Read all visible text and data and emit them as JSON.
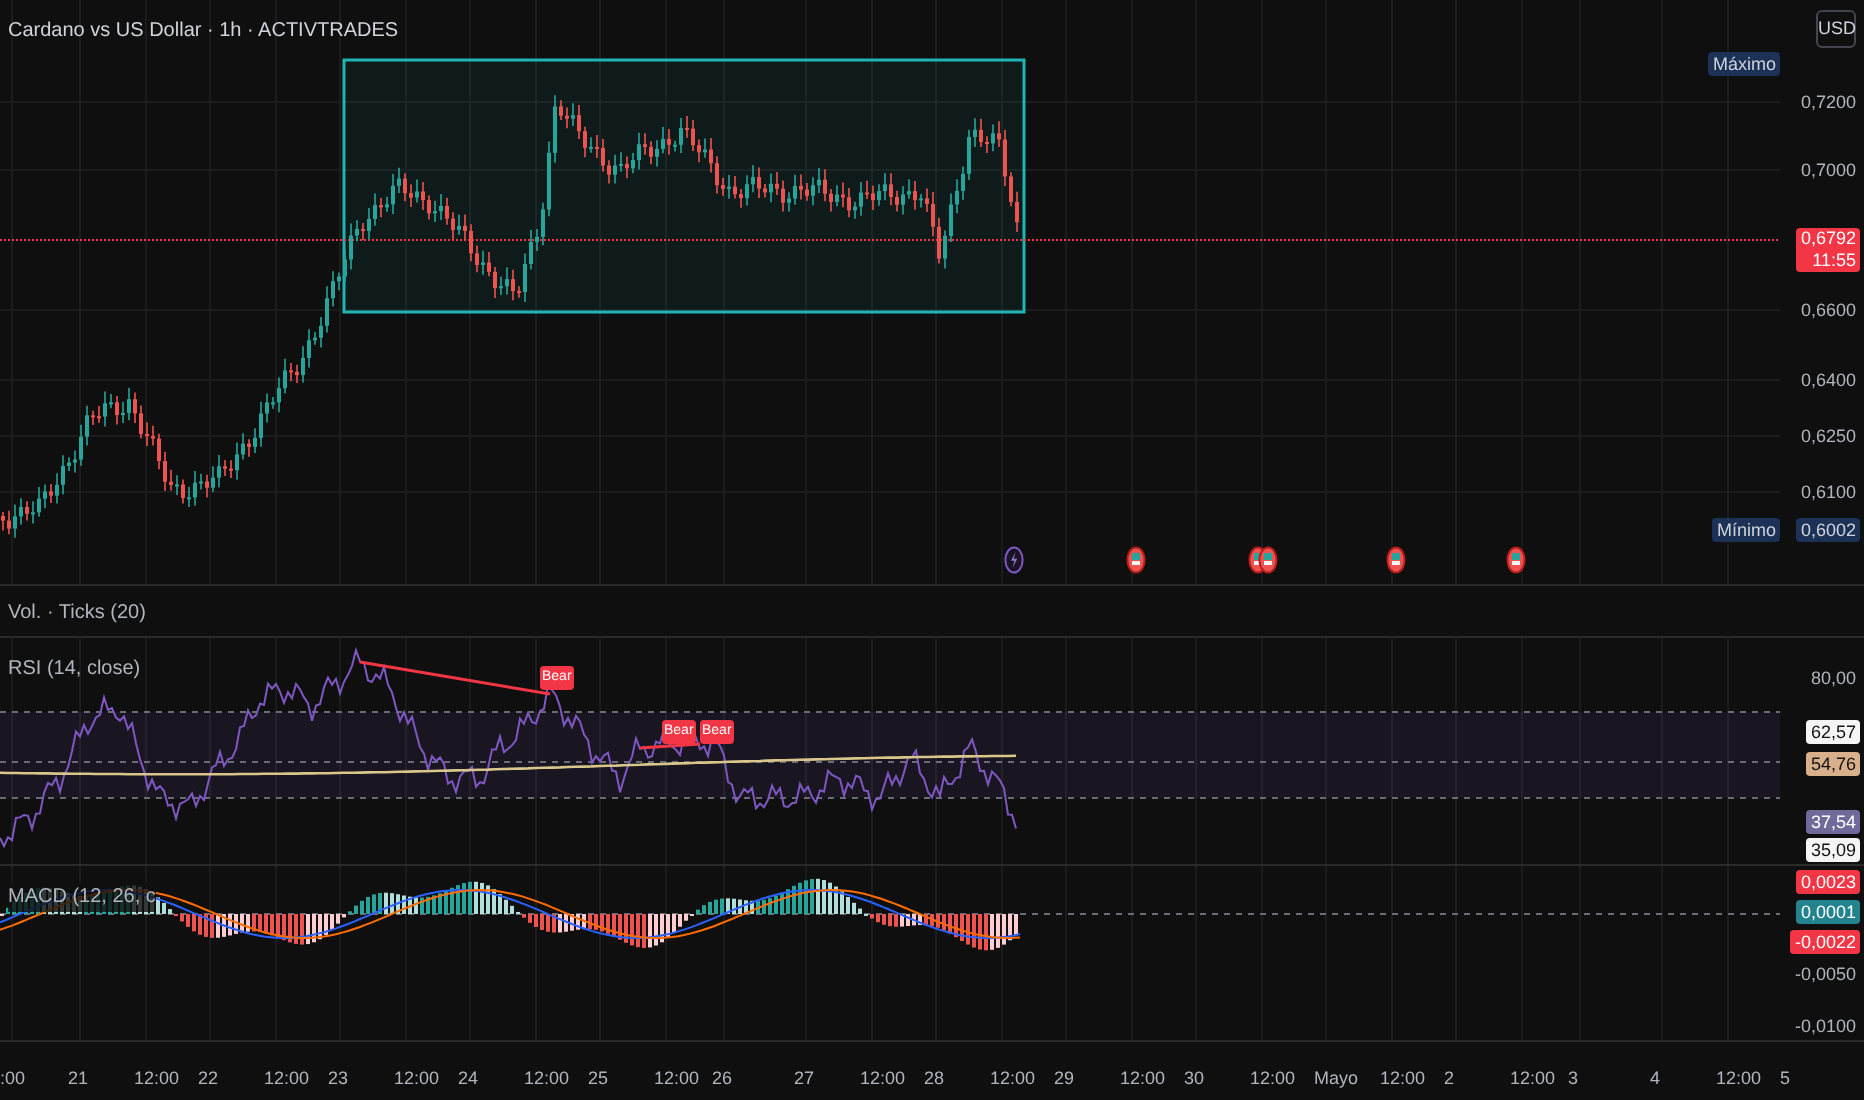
{
  "header": {
    "title": "Cardano vs US Dollar · 1h · ACTIVTRADES",
    "currency_button": "USD"
  },
  "price_axis": {
    "max_label": "Máximo",
    "ticks": [
      "0,7200",
      "0,7000",
      "0,6600",
      "0,6400",
      "0,6250",
      "0,6100"
    ],
    "last_price": "0,6792",
    "countdown": "11:55",
    "min_label": "Mínimo",
    "min_value": "0,6002"
  },
  "events": [
    {
      "kind": "lightning"
    },
    {
      "kind": "earnings"
    },
    {
      "kind": "earnings"
    },
    {
      "kind": "earnings"
    },
    {
      "kind": "earnings"
    },
    {
      "kind": "earnings"
    }
  ],
  "volume_pane": {
    "title": "Vol. · Ticks (20)"
  },
  "rsi_pane": {
    "title": "RSI (14, close)",
    "axis_label": "80,00",
    "signals": [
      "Bear",
      "Bear",
      "Bear"
    ],
    "value_labels": [
      {
        "text": "62,57",
        "color": "#f5f5f5"
      },
      {
        "text": "54,76",
        "color": "#d9b08c"
      },
      {
        "text": "37,54",
        "color": "#6f6a9a"
      },
      {
        "text": "35,09",
        "color": "#f5f5f5"
      }
    ]
  },
  "macd_pane": {
    "title": "MACD (12, 26, c",
    "value_labels": [
      {
        "text": "0,0023",
        "color": "#f23645"
      },
      {
        "text": "0,0001",
        "color": "#22838e"
      },
      {
        "text": "-0,0022",
        "color": "#f23645"
      }
    ],
    "axis_labels": [
      "-0,0050",
      "-0,0100"
    ]
  },
  "time_axis": [
    ":00",
    "21",
    "12:00",
    "22",
    "12:00",
    "23",
    "12:00",
    "24",
    "12:00",
    "25",
    "12:00",
    "26",
    "27",
    "12:00",
    "28",
    "12:00",
    "29",
    "12:00",
    "30",
    "12:00",
    "Mayo",
    "12:00",
    "2",
    "12:00",
    "3",
    "4",
    "12:00",
    "5"
  ]
}
